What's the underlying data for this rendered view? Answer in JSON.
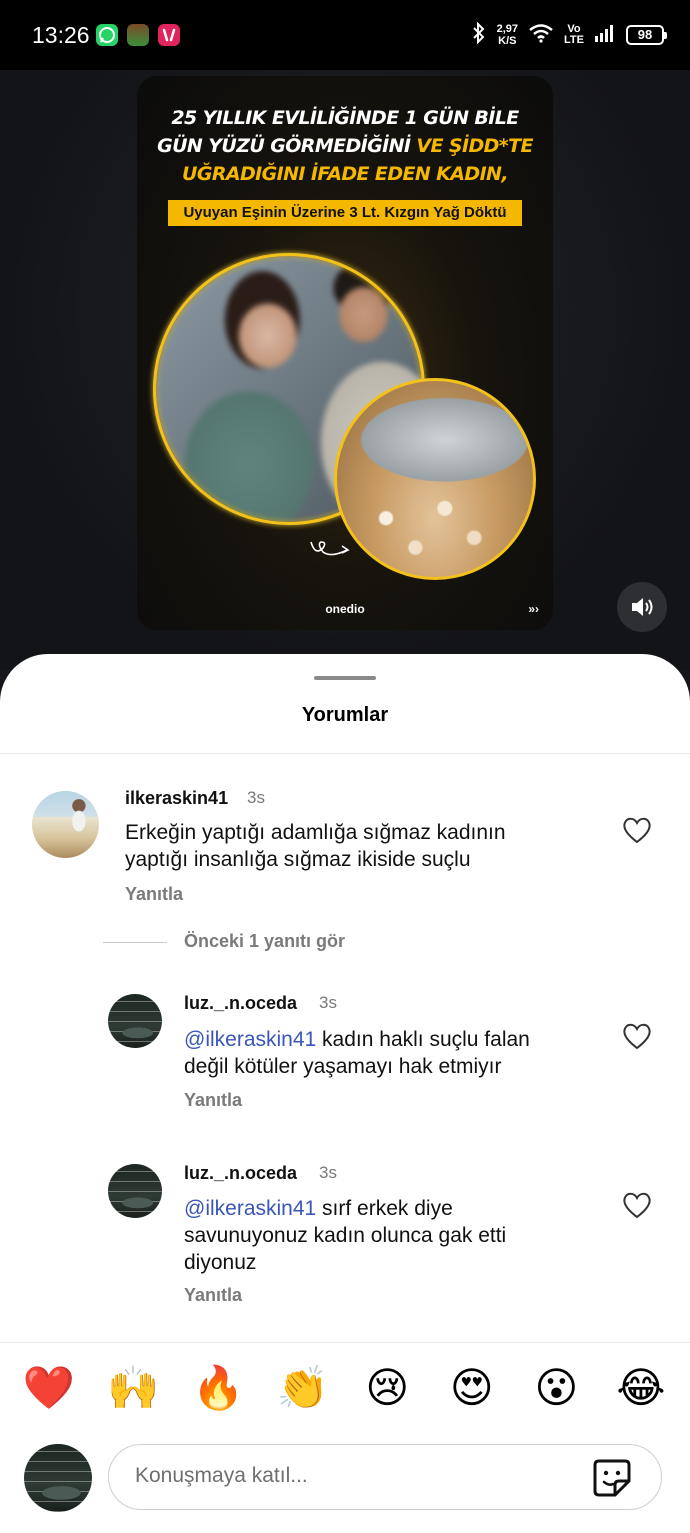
{
  "status_bar": {
    "time": "13:26",
    "net_speed_value": "2,97",
    "net_speed_unit": "K/S",
    "volte_top": "Vo",
    "volte_bottom": "LTE",
    "battery": "98"
  },
  "post": {
    "headline_white_1": "25 YILLIK EVLİLİĞİNDE 1 GÜN BİLE",
    "headline_white_2": "GÜN YÜZÜ GÖRMEDİĞİNİ ",
    "headline_yellow_2": "VE ŞİDD*TE",
    "headline_yellow_3": "UĞRADIĞINI İFADE EDEN KADIN,",
    "banner": "Uyuyan Eşinin Üzerine 3 Lt. Kızgın Yağ Döktü",
    "brand": "onedio",
    "more_glyph": "»›"
  },
  "sheet": {
    "title": "Yorumlar",
    "more_replies": "Önceki 1 yanıtı gör",
    "input_placeholder": "Konuşmaya katıl..."
  },
  "comments": [
    {
      "username": "ilkeraskin41",
      "time": "3s",
      "mention": "",
      "text_line1": "Erkeğin yaptığı adamlığa sığmaz kadının",
      "text_line2": "yaptığı insanlığa sığmaz ikiside suçlu",
      "reply_label": "Yanıtla"
    },
    {
      "username": "luz._.n.oceda",
      "time": "3s",
      "mention": "@ilkeraskin41",
      "text_line1": " kadın haklı suçlu falan",
      "text_line2": "değil kötüler yaşamayı hak etmiyır",
      "reply_label": "Yanıtla"
    },
    {
      "username": "luz._.n.oceda",
      "time": "3s",
      "mention": "@ilkeraskin41",
      "text_line1": " sırf erkek diye",
      "text_line2": "savunuyonuz kadın  olunca gak etti",
      "text_line3": "diyonuz",
      "reply_label": "Yanıtla"
    }
  ],
  "reactions": [
    "❤️",
    "🙌",
    "🔥",
    "👏",
    "😢",
    "😍",
    "😮",
    "😂"
  ],
  "colors": {
    "accent_yellow": "#f5b800",
    "mention_blue": "#3a56b8",
    "sheet_bg": "#ffffff",
    "status_bar_bg": "#000000"
  },
  "icons": [
    "whatsapp-icon",
    "game-app-icon",
    "app-icon",
    "bluetooth-icon",
    "wifi-icon",
    "signal-icon",
    "sound-on-icon",
    "heart-icon",
    "sticker-icon"
  ]
}
